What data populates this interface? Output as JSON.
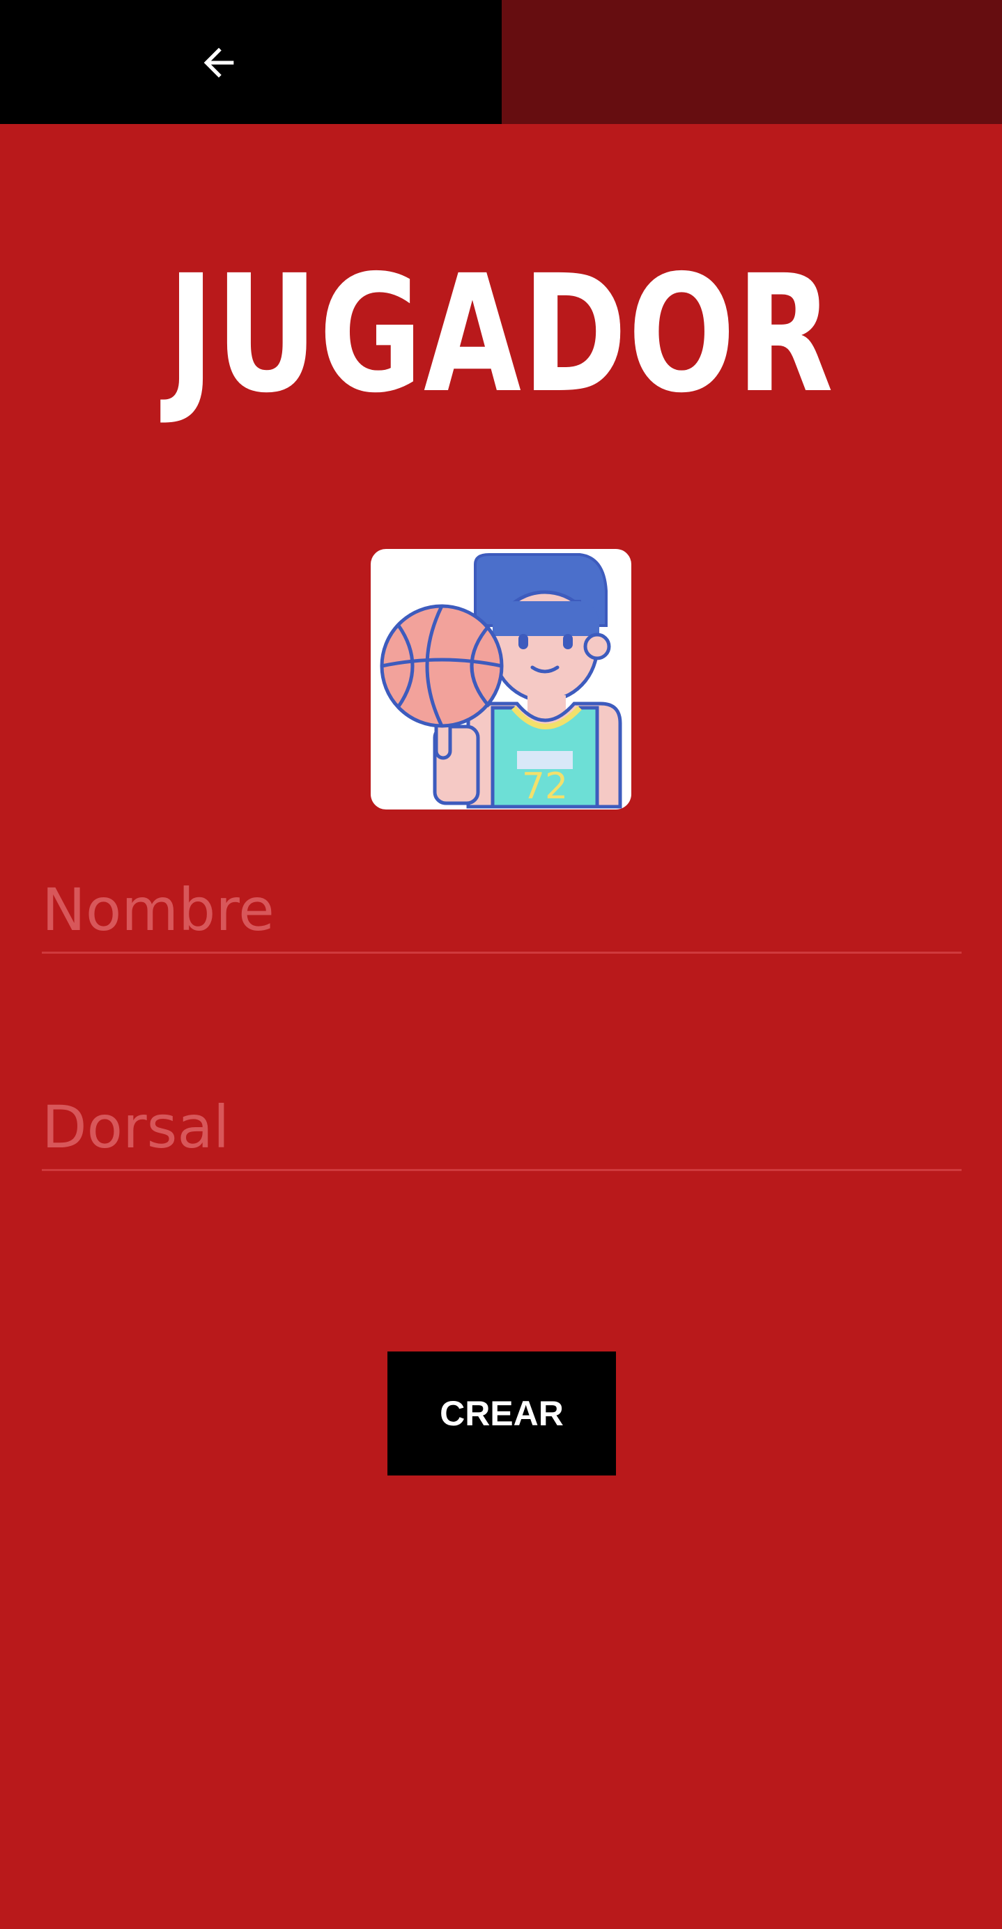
{
  "header": {
    "back_icon": "arrow-left-icon",
    "colors": {
      "left": "#000000",
      "right": "#660d10"
    }
  },
  "title": "JUGADOR",
  "avatar": {
    "icon": "basketball-player-icon",
    "jersey_number": "72"
  },
  "form": {
    "nombre": {
      "placeholder": "Nombre",
      "value": ""
    },
    "dorsal": {
      "placeholder": "Dorsal",
      "value": ""
    }
  },
  "actions": {
    "crear_label": "CREAR"
  },
  "colors": {
    "background": "#b9191b",
    "placeholder": "#d8575a",
    "button": "#000000"
  }
}
